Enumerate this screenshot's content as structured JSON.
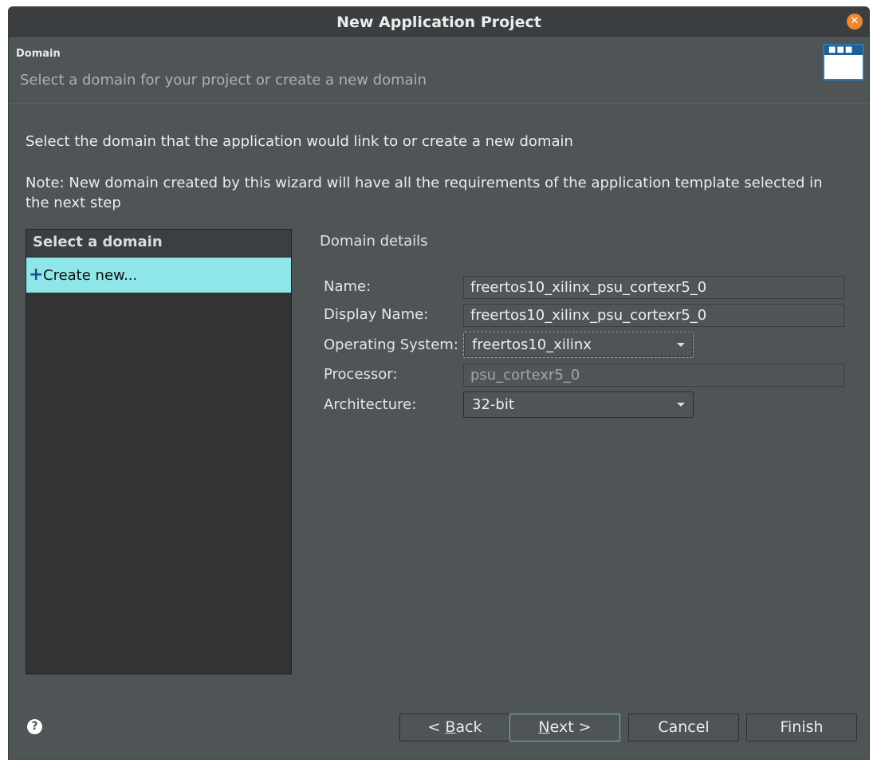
{
  "window": {
    "title": "New Application Project"
  },
  "header": {
    "section_label": "Domain",
    "description": "Select a domain for your project or create a new domain"
  },
  "body": {
    "instruction": "Select the domain that the application would link to or create a new domain",
    "note": "Note: New domain created by this wizard will have all the requirements of the application template selected in the next step"
  },
  "domain_list": {
    "header": "Select a domain",
    "items": [
      {
        "label": "Create new...",
        "icon": "plus-icon",
        "selected": true
      }
    ]
  },
  "details": {
    "title": "Domain details",
    "name": {
      "label": "Name:",
      "value": "freertos10_xilinx_psu_cortexr5_0"
    },
    "display_name": {
      "label": "Display Name:",
      "value": "freertos10_xilinx_psu_cortexr5_0"
    },
    "os": {
      "label": "Operating System:",
      "value": "freertos10_xilinx"
    },
    "processor": {
      "label": "Processor:",
      "value": "psu_cortexr5_0"
    },
    "architecture": {
      "label": "Architecture:",
      "value": "32-bit"
    }
  },
  "buttons": {
    "back_prefix": "< ",
    "back_mnemonic": "B",
    "back_rest": "ack",
    "next_mnemonic": "N",
    "next_rest": "ext >",
    "cancel": "Cancel",
    "finish": "Finish"
  },
  "colors": {
    "accent_selection": "#8fe6e8",
    "close_button": "#f0862f",
    "default_button_border": "#6fbf9a"
  }
}
